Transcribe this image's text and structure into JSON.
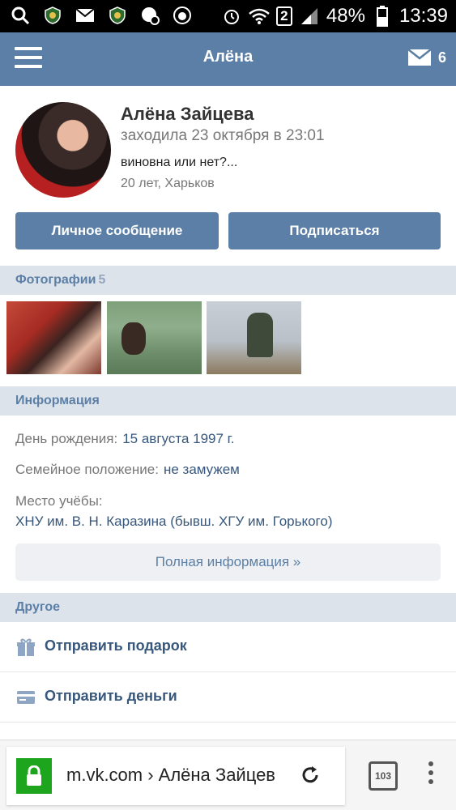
{
  "status_bar": {
    "battery": "48%",
    "time": "13:39",
    "sim": "2",
    "icons": [
      "search-icon",
      "shield-app-icon",
      "mail-icon",
      "shield-app-icon",
      "chat-icon",
      "lion-app-icon",
      "alarm-icon",
      "wifi-icon",
      "sim-badge",
      "signal-icon",
      "battery-icon"
    ]
  },
  "header": {
    "title": "Алёна",
    "mail_count": "6"
  },
  "profile": {
    "name": "Алёна Зайцева",
    "last_seen": "заходила 23 октября в 23:01",
    "status": "виновна или нет?...",
    "age_location": "20 лет, Харьков",
    "message_button": "Личное сообщение",
    "subscribe_button": "Подписаться"
  },
  "photos": {
    "label": "Фотографии",
    "count": "5"
  },
  "info": {
    "label": "Информация",
    "birthday_label": "День рождения:",
    "birthday_value": "15 августа 1997 г.",
    "family_label": "Семейное положение:",
    "family_value": "не замужем",
    "study_label": "Место учёбы:",
    "study_value": "ХНУ им. В. Н. Каразина (бывш. ХГУ им. Горького)",
    "full_info_button": "Полная информация »"
  },
  "other": {
    "label": "Другое",
    "items": [
      {
        "label": "Отправить подарок",
        "icon": "gift-icon"
      },
      {
        "label": "Отправить деньги",
        "icon": "card-icon"
      }
    ]
  },
  "browser": {
    "url": "m.vk.com › Алёна Зайцев",
    "tab_count": "103"
  },
  "colors": {
    "brand": "#5b7fa6",
    "section_bg": "#dde3ea",
    "link": "#37577c",
    "lock_green": "#1ea51e"
  }
}
